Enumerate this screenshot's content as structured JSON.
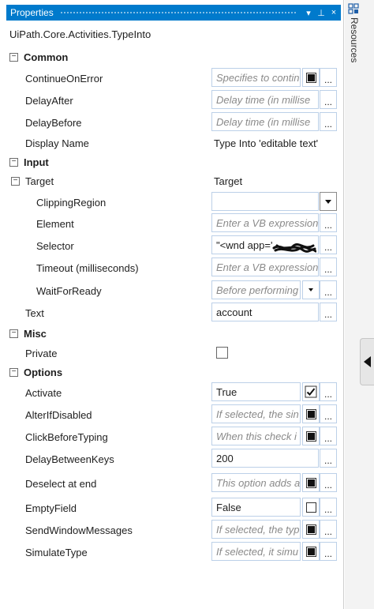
{
  "panel": {
    "title": "Properties",
    "dropdown_glyph": "▾",
    "pin_glyph": "⊥",
    "close_glyph": "×",
    "type_name": "UiPath.Core.Activities.TypeInto"
  },
  "sidebar": {
    "label": "Resources",
    "icon": "resources-icon"
  },
  "common": {
    "category": "Common",
    "continue_on_error": {
      "label": "ContinueOnError",
      "placeholder": "Specifies to contin",
      "checked": true
    },
    "delay_after": {
      "label": "DelayAfter",
      "placeholder": "Delay time (in millise"
    },
    "delay_before": {
      "label": "DelayBefore",
      "placeholder": "Delay time (in millise"
    },
    "display_name": {
      "label": "Display Name",
      "value": "Type Into 'editable text'"
    }
  },
  "input": {
    "category": "Input",
    "target": {
      "label": "Target",
      "value": "Target"
    },
    "clipping_region": {
      "label": "ClippingRegion",
      "value": ""
    },
    "element": {
      "label": "Element",
      "placeholder": "Enter a VB expression"
    },
    "selector": {
      "label": "Selector",
      "value": "\"<wnd app='"
    },
    "timeout": {
      "label": "Timeout (milliseconds)",
      "placeholder": "Enter a VB expression"
    },
    "wait_for_ready": {
      "label": "WaitForReady",
      "placeholder": "Before performing"
    },
    "text": {
      "label": "Text",
      "value": "account"
    }
  },
  "misc": {
    "category": "Misc",
    "private": {
      "label": "Private",
      "checked": false
    }
  },
  "options": {
    "category": "Options",
    "activate": {
      "label": "Activate",
      "value": "True",
      "checked": true
    },
    "alter_if_disabled": {
      "label": "AlterIfDisabled",
      "placeholder": "If selected, the sin",
      "checked": true
    },
    "click_before_typing": {
      "label": "ClickBeforeTyping",
      "placeholder": "When this check i",
      "checked": true
    },
    "delay_between_keys": {
      "label": "DelayBetweenKeys",
      "value": "200"
    },
    "deselect_at_end": {
      "label": "Deselect at end",
      "placeholder": "This option adds a",
      "checked": true
    },
    "empty_field": {
      "label": "EmptyField",
      "value": "False",
      "checked": false
    },
    "send_window_messages": {
      "label": "SendWindowMessages",
      "placeholder": "If selected, the typ",
      "checked": true
    },
    "simulate_type": {
      "label": "SimulateType",
      "placeholder": "If selected, it simu",
      "checked": true
    }
  },
  "ellipsis_label": "...",
  "colors": {
    "title_bar": "#007acc",
    "field_border": "#bcd0e8",
    "placeholder_text": "#8a8a8a"
  }
}
